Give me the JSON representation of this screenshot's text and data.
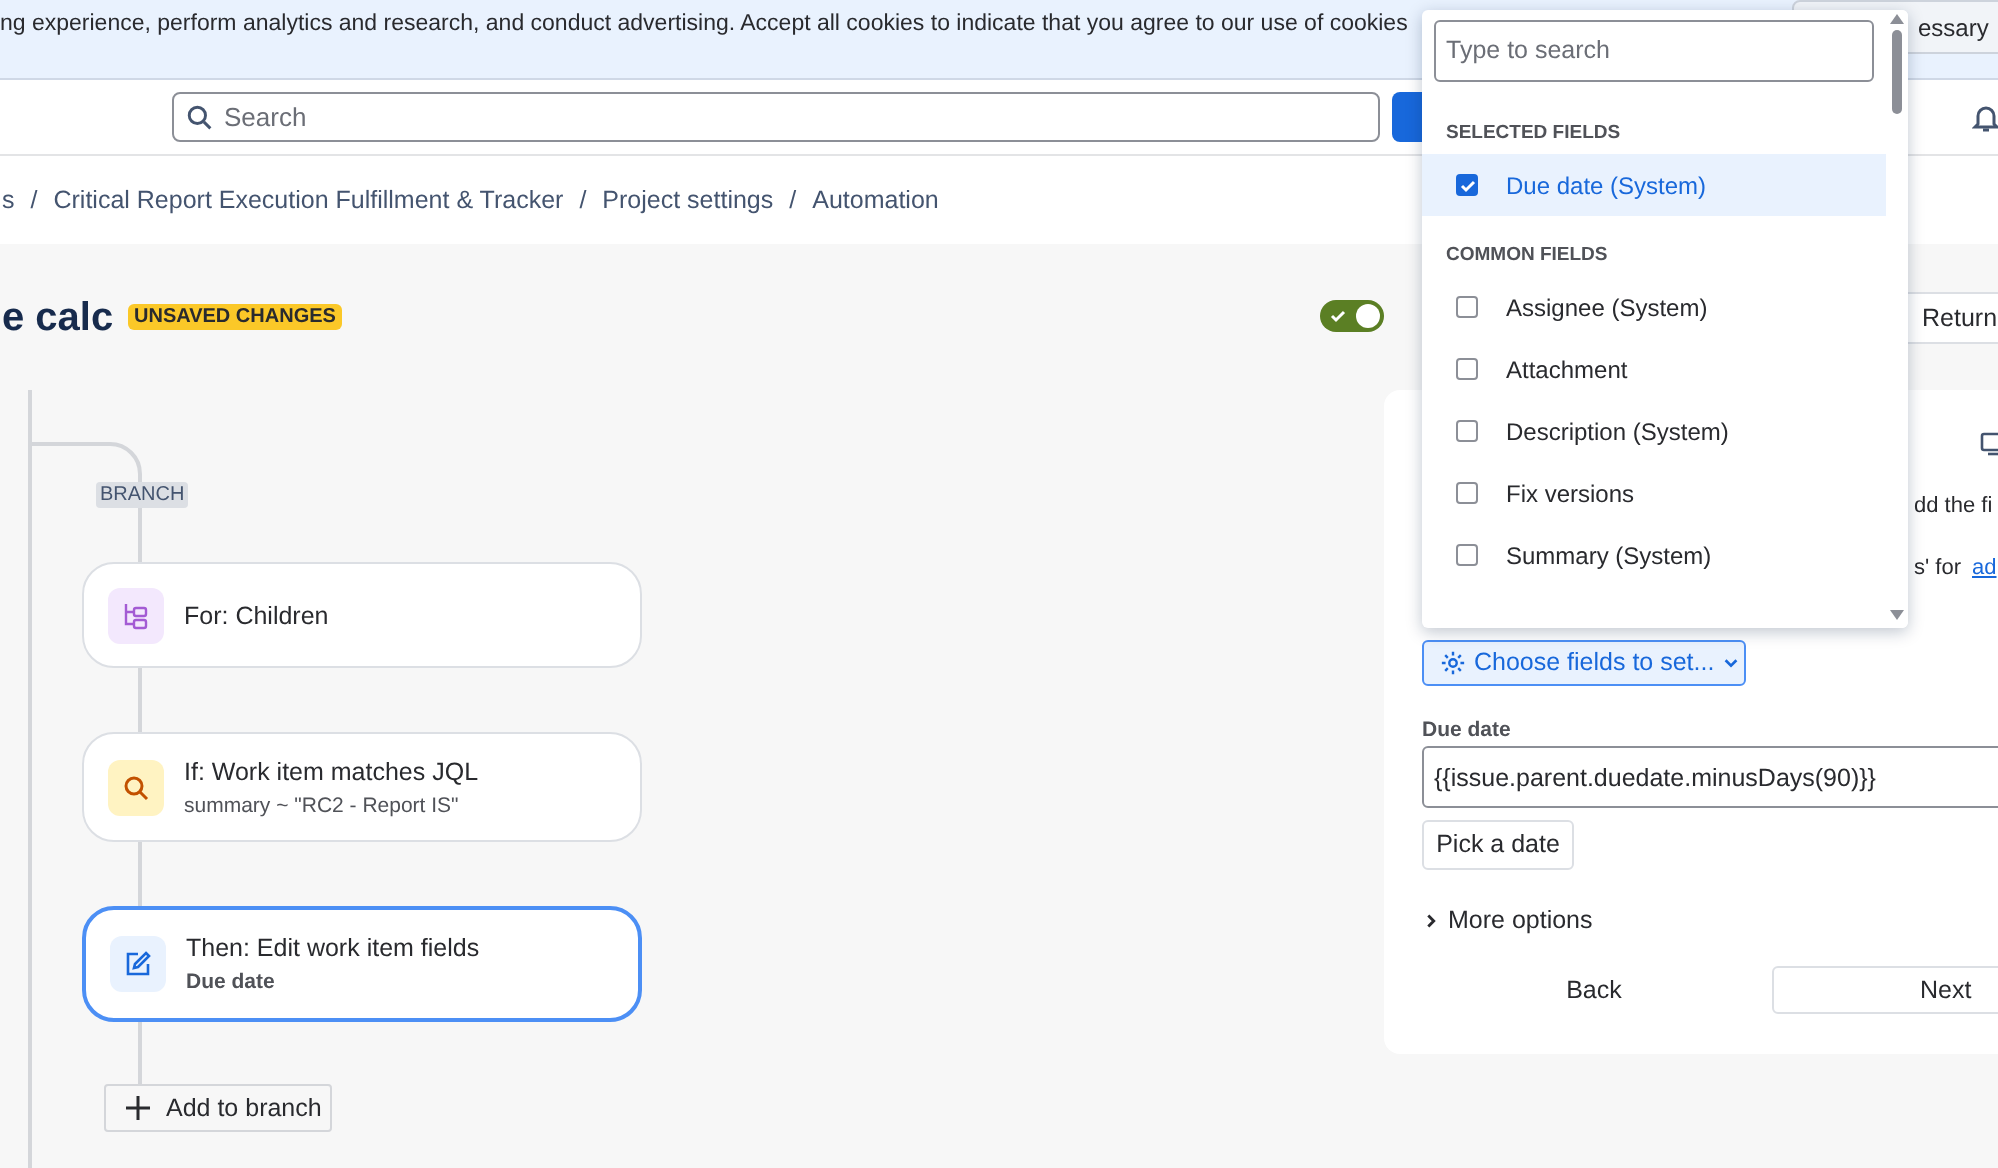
{
  "cookie_banner": {
    "text": "ng experience, perform analytics and research, and conduct advertising. Accept all cookies to indicate that you agree to our use of cookies",
    "button": "essary"
  },
  "header": {
    "search_placeholder": "Search"
  },
  "breadcrumb_separator": "/",
  "breadcrumbs": [
    "s",
    "Critical Report Execution Fulfillment & Tracker",
    "Project settings",
    "Automation"
  ],
  "rule": {
    "title": "e calc",
    "badge": "UNSAVED CHANGES",
    "enabled": true,
    "return_button": "Return"
  },
  "branch": {
    "label": "BRANCH",
    "add_button": "Add to branch",
    "nodes": [
      {
        "kind": "for",
        "title": "For: Children",
        "selected": false
      },
      {
        "kind": "if",
        "title": "If: Work item matches JQL",
        "subtitle": "summary ~ \"RC2 - Report IS\"",
        "selected": false
      },
      {
        "kind": "then",
        "title": "Then: Edit work item fields",
        "subtitle": "Due date",
        "selected": true
      }
    ]
  },
  "panel": {
    "text_1": "dd the fi",
    "text_2": "s' for",
    "link": "ad",
    "choose_button": "Choose fields to set...",
    "field_label": "Due date",
    "field_value": "{{issue.parent.duedate.minusDays(90)}}",
    "pick_button": "Pick a date",
    "more_options": "More options",
    "expanded": false,
    "back_button": "Back",
    "next_button": "Next"
  },
  "field_dropdown": {
    "placeholder": "Type to search",
    "groups": [
      {
        "heading": "SELECTED FIELDS",
        "items": [
          {
            "label": "Due date (System)",
            "checked": true,
            "selected": true
          }
        ]
      },
      {
        "heading": "COMMON FIELDS",
        "items": [
          {
            "label": "Assignee (System)",
            "checked": false,
            "selected": false
          },
          {
            "label": "Attachment",
            "checked": false,
            "selected": false
          },
          {
            "label": "Description (System)",
            "checked": false,
            "selected": false
          },
          {
            "label": "Fix versions",
            "checked": false,
            "selected": false
          },
          {
            "label": "Summary (System)",
            "checked": false,
            "selected": false
          }
        ]
      }
    ]
  }
}
